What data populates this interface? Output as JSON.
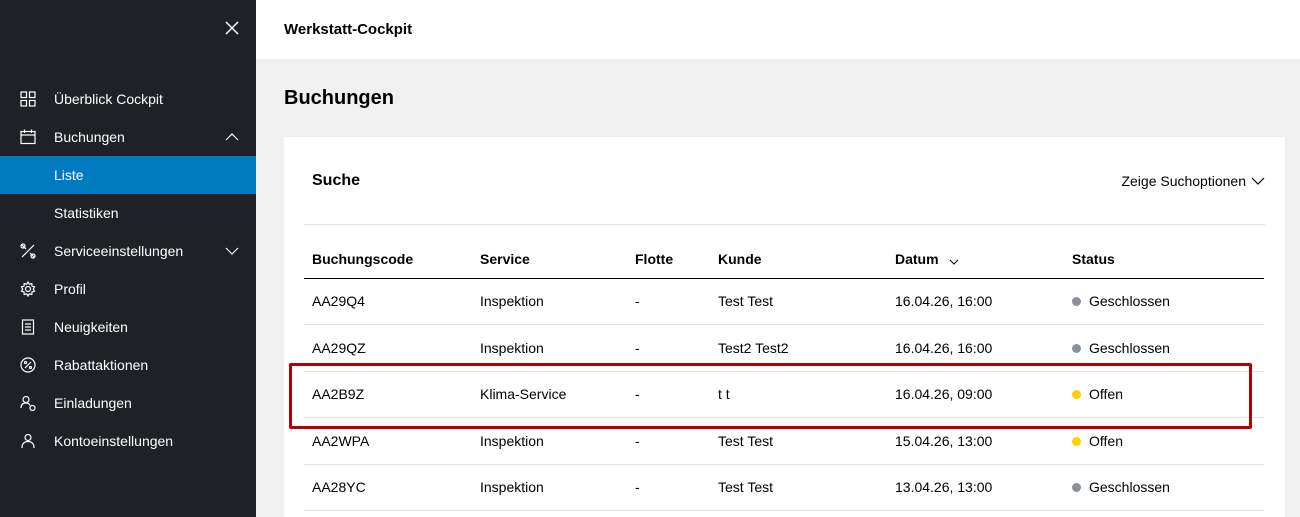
{
  "colors": {
    "sidebar_bg": "#1e2125",
    "active_item": "#007bc0",
    "status_closed": "#8a9097",
    "status_open": "#ffcf00",
    "highlight": "#b40000"
  },
  "app": {
    "title": "Werkstatt-Cockpit"
  },
  "sidebar": {
    "close_icon": "close-icon",
    "items": [
      {
        "label": "Überblick Cockpit",
        "icon": "grid-icon"
      },
      {
        "label": "Buchungen",
        "icon": "calendar-icon",
        "expanded": true,
        "children": [
          {
            "label": "Liste",
            "active": true
          },
          {
            "label": "Statistiken"
          }
        ]
      },
      {
        "label": "Serviceeinstellungen",
        "icon": "tools-icon",
        "expanded": false
      },
      {
        "label": "Profil",
        "icon": "gear-icon"
      },
      {
        "label": "Neuigkeiten",
        "icon": "clipboard-icon"
      },
      {
        "label": "Rabattaktionen",
        "icon": "percent-icon"
      },
      {
        "label": "Einladungen",
        "icon": "invite-user-icon"
      },
      {
        "label": "Kontoeinstellungen",
        "icon": "user-icon"
      }
    ]
  },
  "page": {
    "title": "Buchungen"
  },
  "search": {
    "title": "Suche",
    "toggle_label": "Zeige Suchoptionen"
  },
  "table": {
    "headers": [
      "Buchungscode",
      "Service",
      "Flotte",
      "Kunde",
      "Datum",
      "Status"
    ],
    "rows": [
      {
        "code": "AA29Q4",
        "service": "Inspektion",
        "fleet": "-",
        "customer": "Test Test",
        "date": "16.04.26, 16:00",
        "status": "Geschlossen",
        "status_type": "closed"
      },
      {
        "code": "AA29QZ",
        "service": "Inspektion",
        "fleet": "-",
        "customer": "Test2 Test2",
        "date": "16.04.26, 16:00",
        "status": "Geschlossen",
        "status_type": "closed"
      },
      {
        "code": "AA2B9Z",
        "service": "Klima-Service",
        "fleet": "-",
        "customer": "t t",
        "date": "16.04.26, 09:00",
        "status": "Offen",
        "status_type": "open"
      },
      {
        "code": "AA2WPA",
        "service": "Inspektion",
        "fleet": "-",
        "customer": "Test Test",
        "date": "15.04.26, 13:00",
        "status": "Offen",
        "status_type": "open"
      },
      {
        "code": "AA28YC",
        "service": "Inspektion",
        "fleet": "-",
        "customer": "Test Test",
        "date": "13.04.26, 13:00",
        "status": "Geschlossen",
        "status_type": "closed"
      }
    ]
  }
}
